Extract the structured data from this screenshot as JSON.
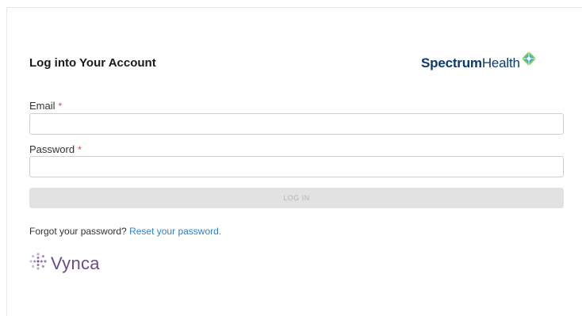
{
  "form": {
    "title": "Log into Your Account",
    "email_label": "Email",
    "email_required_mark": "*",
    "email_value": "",
    "password_label": "Password",
    "password_required_mark": "*",
    "password_value": "",
    "login_button": "LOG IN"
  },
  "brand": {
    "name_bold": "Spectrum",
    "name_light": "Health",
    "logo_icon": "spectrum-diamond-icon",
    "text_color": "#0d3a6e"
  },
  "footer": {
    "forgot_text": "Forgot your password?",
    "reset_link": "Reset your password.",
    "link_color": "#2f80d1",
    "partner_name": "Vynca",
    "partner_icon": "vynca-dot-circle-icon",
    "partner_color": "#6b4c8a"
  },
  "colors": {
    "required": "#e0443a",
    "button_disabled_bg": "#e2e2e2",
    "button_disabled_text": "#b4b4b4"
  }
}
